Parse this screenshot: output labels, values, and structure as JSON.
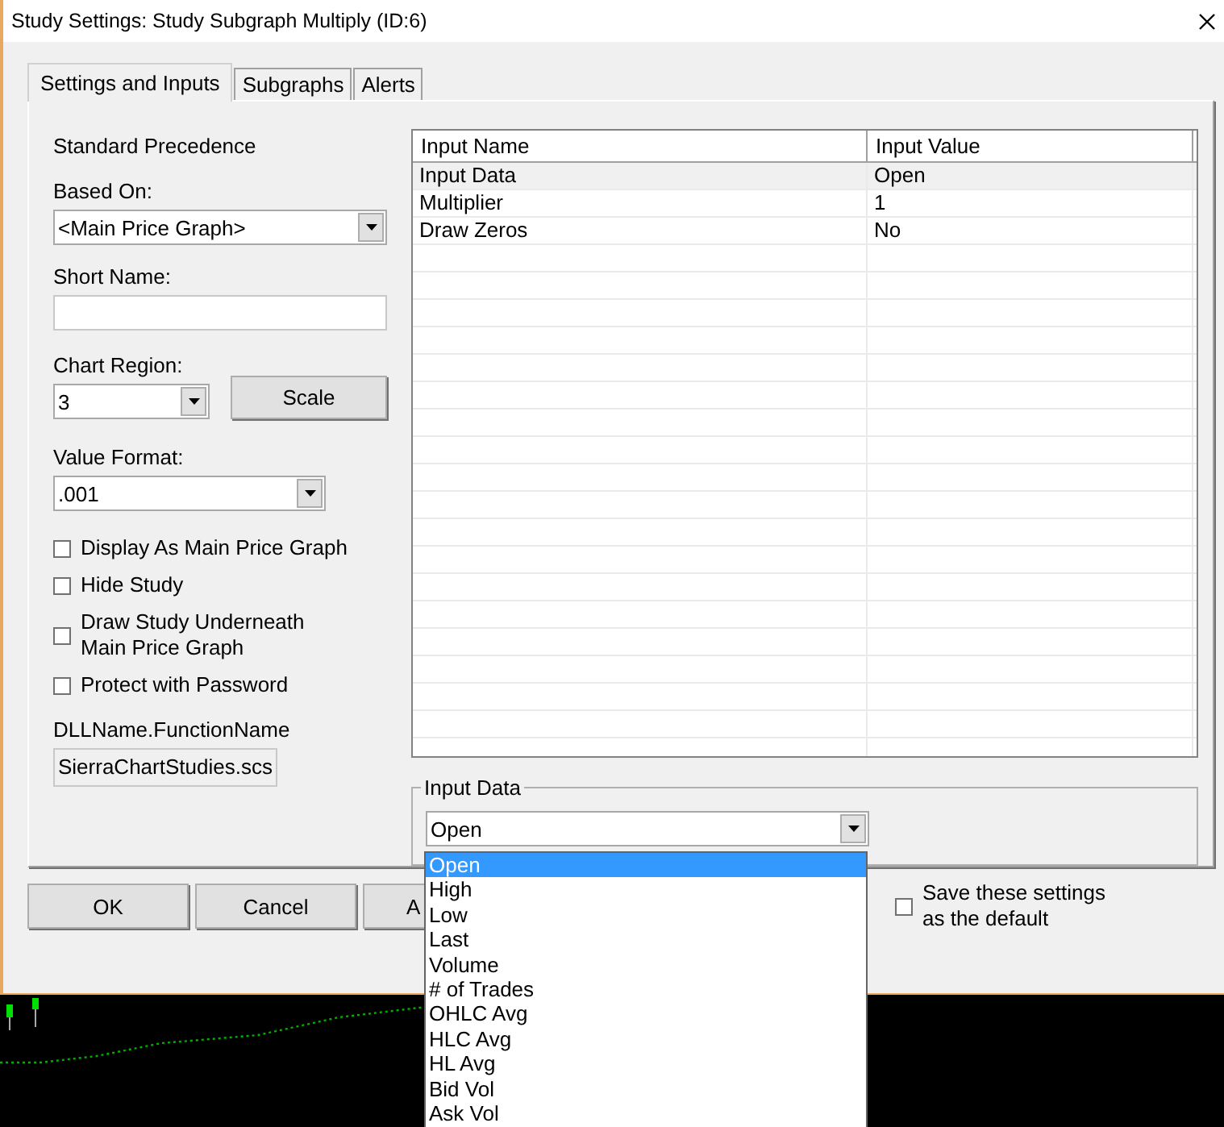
{
  "window": {
    "title": "Study Settings: Study Subgraph Multiply (ID:6)"
  },
  "tabs": [
    {
      "label": "Settings and Inputs",
      "selected": true
    },
    {
      "label": "Subgraphs",
      "selected": false
    },
    {
      "label": "Alerts",
      "selected": false
    }
  ],
  "settings": {
    "heading": "Standard Precedence",
    "based_on": {
      "label": "Based On:",
      "value": "<Main Price Graph>"
    },
    "short_name": {
      "label": "Short Name:"
    },
    "chart_region": {
      "label": "Chart Region:",
      "value": "3"
    },
    "scale_button": "Scale",
    "value_format": {
      "label": "Value Format:",
      "value": ".001"
    },
    "options": [
      {
        "label": "Display As Main Price Graph",
        "checked": false
      },
      {
        "label": "Hide Study",
        "checked": false
      },
      {
        "label": "Draw Study Underneath Main Price Graph",
        "checked": false
      },
      {
        "label": "Protect with Password",
        "checked": false
      }
    ],
    "dll": {
      "label": "DLLName.FunctionName",
      "value": "SierraChartStudies.scs"
    }
  },
  "inputs_table": {
    "columns": [
      "Input Name",
      "Input Value"
    ],
    "rows": [
      {
        "name": "Input Data",
        "value": "Open",
        "selected": true
      },
      {
        "name": "Multiplier",
        "value": "1",
        "selected": false
      },
      {
        "name": "Draw Zeros",
        "value": "No",
        "selected": false
      }
    ]
  },
  "input_data_group": {
    "title": "Input Data",
    "value": "Open",
    "options": [
      {
        "label": "Open",
        "selected": true
      },
      {
        "label": "High",
        "selected": false
      },
      {
        "label": "Low",
        "selected": false
      },
      {
        "label": "Last",
        "selected": false
      },
      {
        "label": "Volume",
        "selected": false
      },
      {
        "label": "# of Trades",
        "selected": false
      },
      {
        "label": "OHLC Avg",
        "selected": false
      },
      {
        "label": "HLC Avg",
        "selected": false
      },
      {
        "label": "HL Avg",
        "selected": false
      },
      {
        "label": "Bid Vol",
        "selected": false
      },
      {
        "label": "Ask Vol",
        "selected": false
      }
    ]
  },
  "buttons": [
    "OK",
    "Cancel",
    "A"
  ],
  "save_default": {
    "label": "Save these settings as the default",
    "checked": false
  }
}
